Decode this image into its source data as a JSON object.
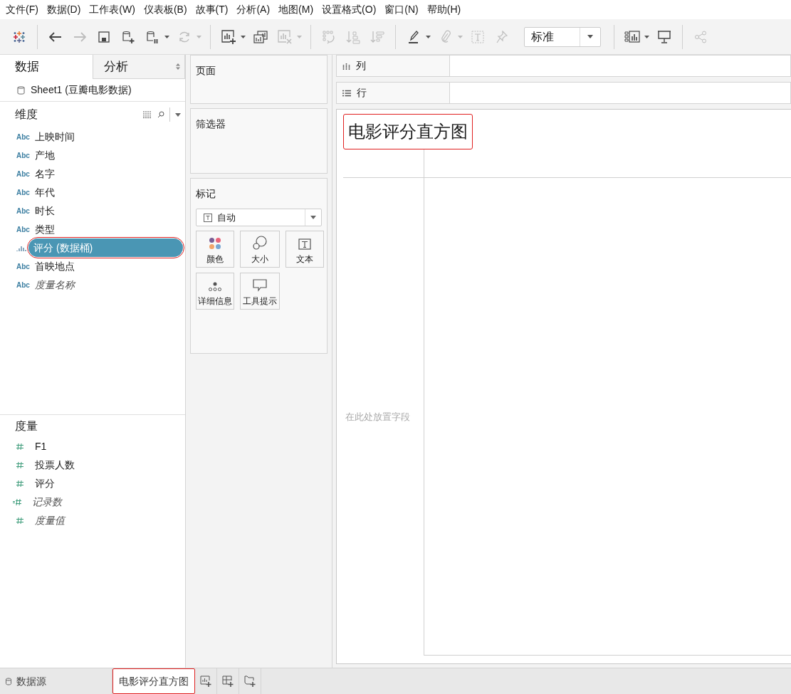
{
  "menu": [
    "文件(F)",
    "数据(D)",
    "工作表(W)",
    "仪表板(B)",
    "故事(T)",
    "分析(A)",
    "地图(M)",
    "设置格式(O)",
    "窗口(N)",
    "帮助(H)"
  ],
  "toolbar": [
    {
      "kind": "logo"
    },
    {
      "kind": "separator"
    },
    {
      "kind": "button",
      "disabled": false,
      "menu": false
    },
    {
      "kind": "button",
      "disabled": true,
      "menu": false
    },
    {
      "kind": "button",
      "disabled": false,
      "menu": false
    },
    {
      "kind": "button",
      "disabled": false,
      "menu": false
    },
    {
      "kind": "button",
      "disabled": false,
      "menu": true
    },
    {
      "kind": "button",
      "disabled": true,
      "menu": true
    },
    {
      "kind": "separator"
    },
    {
      "kind": "button",
      "disabled": false,
      "menu": true
    },
    {
      "kind": "button",
      "disabled": false,
      "menu": false
    },
    {
      "kind": "button",
      "disabled": true,
      "menu": true
    },
    {
      "kind": "separator"
    },
    {
      "kind": "button",
      "disabled": true,
      "menu": false
    },
    {
      "kind": "button",
      "disabled": true,
      "menu": false
    },
    {
      "kind": "button",
      "disabled": true,
      "menu": false
    },
    {
      "kind": "separator"
    },
    {
      "kind": "button",
      "disabled": false,
      "menu": true
    },
    {
      "kind": "button",
      "disabled": true,
      "menu": true
    },
    {
      "kind": "button",
      "disabled": true,
      "menu": false
    },
    {
      "kind": "button",
      "disabled": true,
      "menu": false
    },
    {
      "kind": "select",
      "value": "标准"
    },
    {
      "kind": "separator"
    },
    {
      "kind": "button",
      "disabled": false,
      "menu": true
    },
    {
      "kind": "button",
      "disabled": false,
      "menu": false
    },
    {
      "kind": "separator"
    },
    {
      "kind": "button",
      "disabled": true,
      "menu": false
    }
  ],
  "side_tabs": [
    {
      "label": "数据",
      "selected": true
    },
    {
      "label": "分析",
      "selected": false
    }
  ],
  "data_source": "Sheet1 (豆瓣电影数据)",
  "dimensions": {
    "title": "维度",
    "fields": [
      {
        "name": "上映时间",
        "kind": "text",
        "type_label": "Abc",
        "italic": false,
        "selected": false,
        "highlighted": false
      },
      {
        "name": "产地",
        "kind": "text",
        "type_label": "Abc",
        "italic": false,
        "selected": false,
        "highlighted": false
      },
      {
        "name": "名字",
        "kind": "text",
        "type_label": "Abc",
        "italic": false,
        "selected": false,
        "highlighted": false
      },
      {
        "name": "年代",
        "kind": "text",
        "type_label": "Abc",
        "italic": false,
        "selected": false,
        "highlighted": false
      },
      {
        "name": "时长",
        "kind": "text",
        "type_label": "Abc",
        "italic": false,
        "selected": false,
        "highlighted": false
      },
      {
        "name": "类型",
        "kind": "text",
        "type_label": "Abc",
        "italic": false,
        "selected": false,
        "highlighted": false
      },
      {
        "name": "评分 (数据桶)",
        "kind": "bin",
        "italic": false,
        "selected": true,
        "highlighted": true
      },
      {
        "name": "首映地点",
        "kind": "text",
        "type_label": "Abc",
        "italic": false,
        "selected": false,
        "highlighted": false
      },
      {
        "name": "度量名称",
        "kind": "text",
        "type_label": "Abc",
        "italic": true,
        "selected": false,
        "highlighted": false
      }
    ]
  },
  "measures": {
    "title": "度量",
    "fields": [
      {
        "name": "F1",
        "kind": "number",
        "italic": false
      },
      {
        "name": "投票人数",
        "kind": "number",
        "italic": false
      },
      {
        "name": "评分",
        "kind": "number",
        "italic": false
      },
      {
        "name": "记录数",
        "kind": "calculated",
        "italic": true
      },
      {
        "name": "度量值",
        "kind": "number",
        "italic": true
      }
    ]
  },
  "pages_card": {
    "title": "页面"
  },
  "filters_card": {
    "title": "筛选器"
  },
  "marks_card": {
    "title": "标记",
    "mark_type": "自动",
    "buttons": [
      {
        "kind": "color",
        "label": "颜色"
      },
      {
        "kind": "size",
        "label": "大小"
      },
      {
        "kind": "text",
        "label": "文本"
      },
      {
        "kind": "detail",
        "label": "详细信息"
      },
      {
        "kind": "tooltip",
        "label": "工具提示"
      }
    ]
  },
  "shelves": [
    {
      "kind": "columns",
      "label": "列"
    },
    {
      "kind": "rows",
      "label": "行"
    }
  ],
  "view": {
    "title": "电影评分直方图",
    "title_highlighted": true,
    "drop_hint": "在此处放置字段"
  },
  "bottom_tabs": [
    {
      "kind": "datasource",
      "label": "数据源",
      "selected": false,
      "highlighted": false
    },
    {
      "kind": "sheet",
      "label": "电影评分直方图",
      "selected": true,
      "highlighted": true
    }
  ],
  "new_buttons": [
    {
      "kind": "worksheet"
    },
    {
      "kind": "dashboard"
    },
    {
      "kind": "story"
    }
  ]
}
